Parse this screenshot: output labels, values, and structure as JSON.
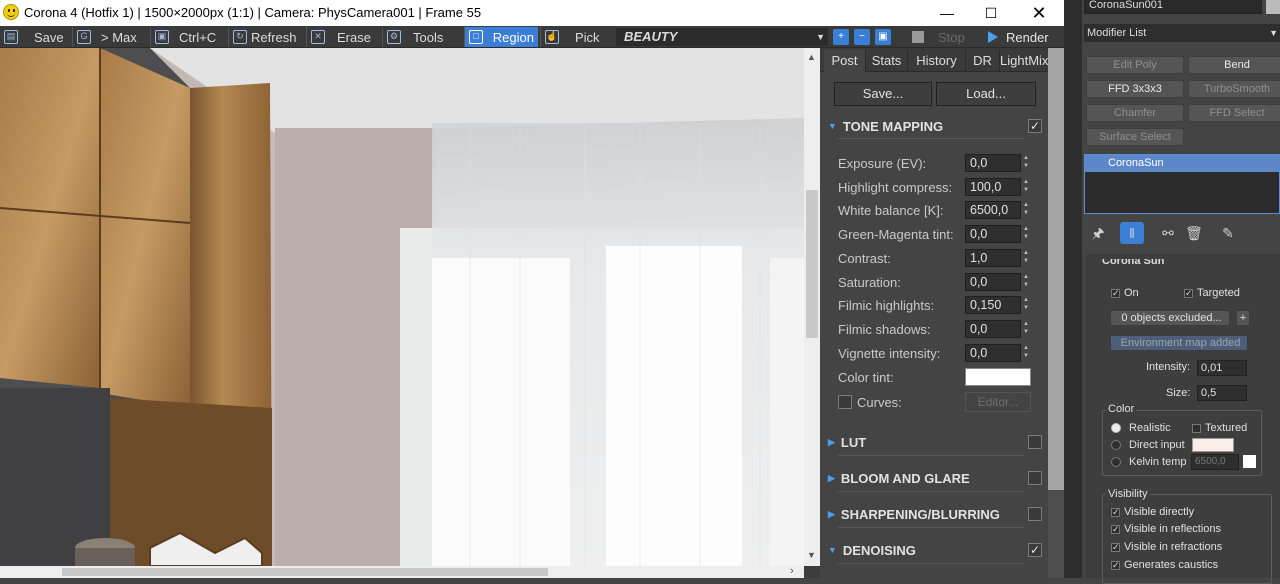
{
  "vfb": {
    "title": "Corona 4 (Hotfix 1) | 1500×2000px (1:1) | Camera: PhysCamera001 | Frame 55",
    "toolbar": {
      "save": "Save",
      "max": "> Max",
      "ctrlc": "Ctrl+C",
      "refresh": "Refresh",
      "erase": "Erase",
      "tools": "Tools",
      "region": "Region",
      "pick": "Pick",
      "render_element": "BEAUTY",
      "stop": "Stop",
      "render": "Render"
    },
    "tabs": [
      "Post",
      "Stats",
      "History",
      "DR",
      "LightMix"
    ],
    "active_tab": "Post",
    "save_btn": "Save...",
    "load_btn": "Load...",
    "tone_mapping": {
      "title": "TONE MAPPING",
      "enabled": true,
      "params": [
        {
          "label": "Exposure (EV):",
          "value": "0,0"
        },
        {
          "label": "Highlight compress:",
          "value": "100,0"
        },
        {
          "label": "White balance [K]:",
          "value": "6500,0"
        },
        {
          "label": "Green-Magenta tint:",
          "value": "0,0"
        },
        {
          "label": "Contrast:",
          "value": "1,0"
        },
        {
          "label": "Saturation:",
          "value": "0,0"
        },
        {
          "label": "Filmic highlights:",
          "value": "0,150"
        },
        {
          "label": "Filmic shadows:",
          "value": "0,0"
        },
        {
          "label": "Vignette intensity:",
          "value": "0,0"
        }
      ],
      "color_tint_label": "Color tint:",
      "color_tint": "#ffffff",
      "curves_label": "Curves:",
      "editor_btn": "Editor..."
    },
    "sections": [
      {
        "title": "LUT",
        "enabled": false
      },
      {
        "title": "BLOOM AND GLARE",
        "enabled": false
      },
      {
        "title": "SHARPENING/BLURRING",
        "enabled": false
      },
      {
        "title": "DENOISING",
        "enabled": true
      }
    ]
  },
  "max": {
    "object_name": "CoronaSun001",
    "modifier_list": "Modifier List",
    "modifier_buttons": [
      {
        "label": "Edit Poly",
        "lit": false
      },
      {
        "label": "Bend",
        "lit": true
      },
      {
        "label": "FFD 3x3x3",
        "lit": true
      },
      {
        "label": "TurboSmooth",
        "lit": false
      },
      {
        "label": "Chamfer",
        "lit": false
      },
      {
        "label": "FFD Select",
        "lit": false
      },
      {
        "label": "Surface Select",
        "lit": false
      }
    ],
    "stack_item": "CoronaSun",
    "rollout_title": "Corona Sun",
    "on_label": "On",
    "targeted_label": "Targeted",
    "excluded_btn": "0 objects excluded...",
    "plus": "+",
    "env_btn": "Environment map added",
    "intensity_label": "Intensity:",
    "intensity_value": "0,01",
    "size_label": "Size:",
    "size_value": "0,5",
    "color_group": "Color",
    "realistic": "Realistic",
    "textured": "Textured",
    "direct_input": "Direct input",
    "kelvin_temp": "Kelvin temp",
    "kelvin_value": "6500,0",
    "visibility_group": "Visibility",
    "visibility": [
      "Visible directly",
      "Visible in reflections",
      "Visible in refractions",
      "Generates caustics"
    ]
  },
  "colors": {
    "accent": "#3b7ed6",
    "panel_bg": "#444444",
    "stack_selected": "#5e87c9"
  }
}
